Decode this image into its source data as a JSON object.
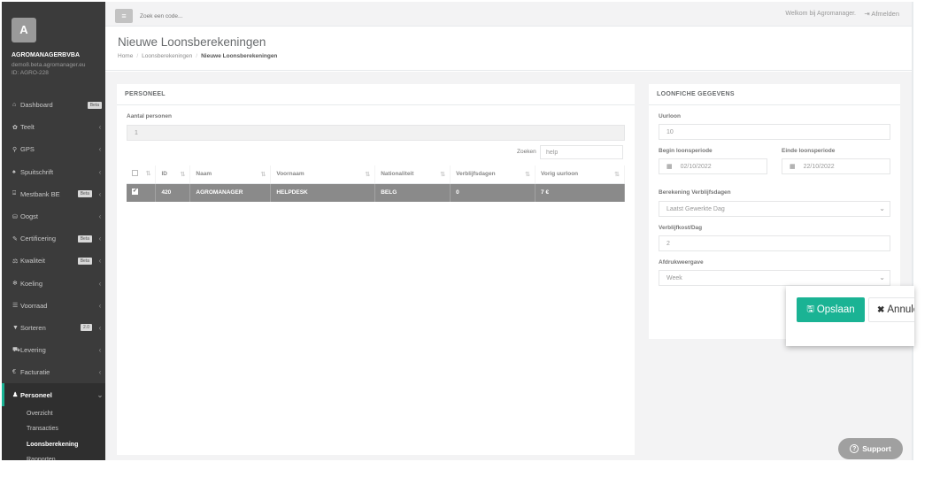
{
  "sidebar": {
    "avatar_letter": "A",
    "company": "AGROMANAGERBVBA",
    "email": "demo8.beta.agromanager.eu",
    "uid": "ID: AGRO-228",
    "items": [
      {
        "icon": "⌂",
        "label": "Dashboard",
        "badge": "Beta"
      },
      {
        "icon": "✿",
        "label": "Teelt",
        "chevron": "‹"
      },
      {
        "icon": "⚲",
        "label": "GPS",
        "chevron": "‹"
      },
      {
        "icon": "♠",
        "label": "Spuitschrift",
        "chevron": "‹"
      },
      {
        "icon": "⌹",
        "label": "Mestbank BE",
        "badge": "Beta",
        "chevron": "‹"
      },
      {
        "icon": "⛁",
        "label": "Oogst",
        "chevron": "‹"
      },
      {
        "icon": "✎",
        "label": "Certificering",
        "badge": "Beta",
        "chevron": "‹"
      },
      {
        "icon": "⚖",
        "label": "Kwaliteit",
        "badge": "Beta",
        "chevron": "‹"
      },
      {
        "icon": "❄",
        "label": "Koeling",
        "chevron": "‹"
      },
      {
        "icon": "☰",
        "label": "Voorraad",
        "chevron": "‹"
      },
      {
        "icon": "▼",
        "label": "Sorteren",
        "badge": "2.0",
        "chevron": "‹"
      },
      {
        "icon": "⛟",
        "label": "Levering",
        "chevron": "‹"
      },
      {
        "icon": "€",
        "label": "Facturatie",
        "chevron": "‹"
      },
      {
        "icon": "♟",
        "label": "Personeel",
        "chevron": "⌄"
      }
    ],
    "sub_items": [
      "Overzicht",
      "Transacties",
      "Loonsberekening",
      "Rapporten"
    ]
  },
  "topbar": {
    "menu_icon": "≡",
    "search_placeholder": "Zoek een code...",
    "welcome": "Welkom bij Agromanager.",
    "logout": "⇥ Afmelden"
  },
  "page": {
    "title": "Nieuwe Loonsberekeningen",
    "breadcrumb": [
      "Home",
      "Loonsberekeningen",
      "Nieuwe Loonsberekeningen"
    ]
  },
  "personeel": {
    "title": "PERSONEEL",
    "count_label": "Aantal personen",
    "count_value": "1",
    "search_label": "Zoeken",
    "search_value": "help",
    "columns": [
      "ID",
      "Naam",
      "Voornaam",
      "Nationaliteit",
      "Verblijfsdagen",
      "Vorig uurloon"
    ],
    "rows": [
      {
        "id": "420",
        "naam": "AGROMANAGER",
        "voornaam": "HELPDESK",
        "nationaliteit": "BELG",
        "verblijfsdagen": "0",
        "vorig_uurloon": "7 €"
      }
    ]
  },
  "loonfiche": {
    "title": "LOONFICHE GEGEVENS",
    "uurloon_label": "Uurloon",
    "uurloon_value": "10",
    "begin_label": "Begin loonsperiode",
    "begin_value": "02/10/2022",
    "einde_label": "Einde loonsperiode",
    "einde_value": "22/10/2022",
    "verblijf_label": "Berekening Verblijfsdagen",
    "verblijf_value": "Laatst Gewerkte Dag",
    "kost_label": "Verblijfkost/Dag",
    "kost_value": "2",
    "afdruk_label": "Afdrukweergave",
    "afdruk_value": "Week"
  },
  "actions": {
    "save": "Opslaan",
    "cancel": "Annuleren"
  },
  "support": "Support"
}
